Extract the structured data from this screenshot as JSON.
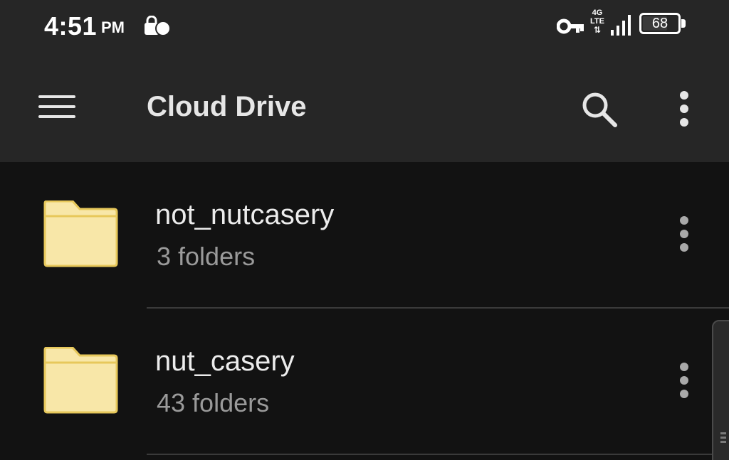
{
  "status_bar": {
    "time": "4:51",
    "ampm": "PM",
    "network_top": "4G",
    "network_bottom": "LTE",
    "battery_level": "68",
    "icons": [
      "notification-icon",
      "vpn-key-icon",
      "lte-icon",
      "signal-icon",
      "battery-icon"
    ]
  },
  "app_bar": {
    "title": "Cloud Drive",
    "icons": [
      "menu-icon",
      "search-icon",
      "overflow-menu-icon"
    ]
  },
  "list": {
    "items": [
      {
        "name": "not_nutcasery",
        "meta": "3 folders",
        "icon": "folder-icon"
      },
      {
        "name": "nut_casery",
        "meta": "43 folders",
        "icon": "folder-icon"
      }
    ]
  },
  "colors": {
    "background": "#121212",
    "bar": "#262626",
    "folder": "#f8e7a8",
    "folder_edge": "#e7c85b",
    "text_primary": "#ececec",
    "text_secondary": "#9a9a9a"
  }
}
